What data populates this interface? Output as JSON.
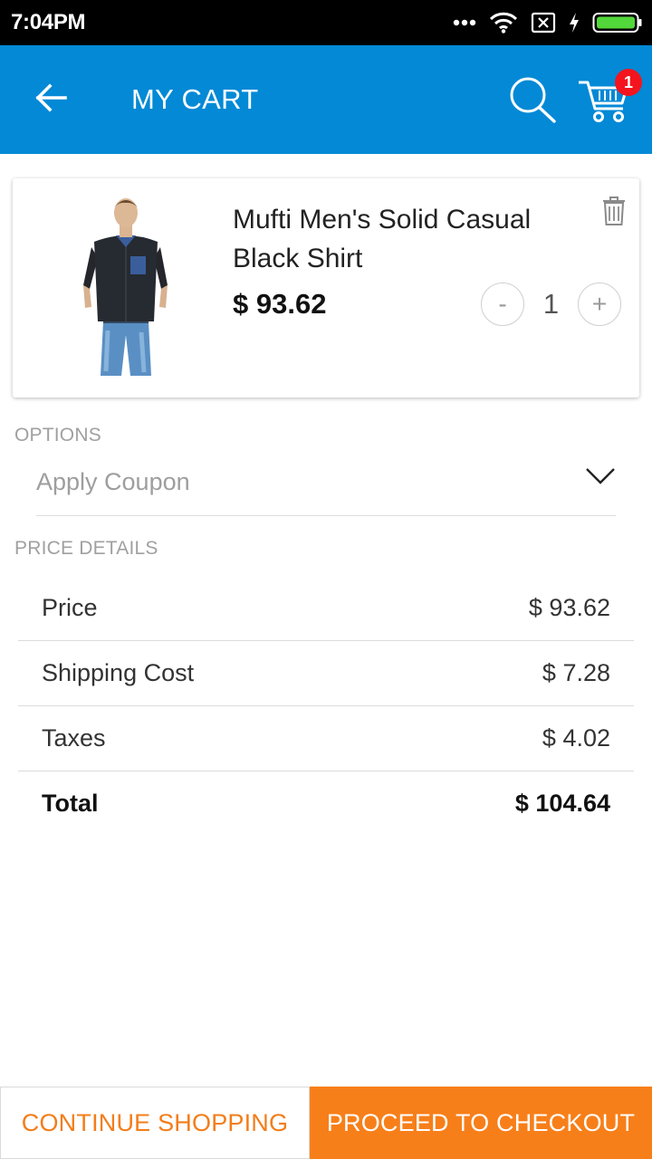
{
  "status_bar": {
    "time": "7:04PM",
    "icons": [
      "more-dots-icon",
      "wifi-icon",
      "no-sim-icon",
      "charging-icon",
      "battery-icon"
    ]
  },
  "app_bar": {
    "title": "MY CART",
    "cart_count": "1",
    "icons": [
      "back-arrow-icon",
      "search-icon",
      "shopping-cart-icon"
    ]
  },
  "cart_item": {
    "name": "Mufti Men's Solid Casual Black Shirt",
    "price": "$ 93.62",
    "quantity": "1",
    "minus_label": "-",
    "plus_label": "+",
    "image": "product-photo-man-in-black-shirt"
  },
  "options": {
    "section_label": "OPTIONS",
    "coupon_label": "Apply Coupon"
  },
  "price_details": {
    "section_label": "PRICE DETAILS",
    "rows": [
      {
        "label": "Price",
        "value": "$ 93.62"
      },
      {
        "label": "Shipping Cost",
        "value": "$ 7.28"
      },
      {
        "label": "Taxes",
        "value": "$ 4.02"
      },
      {
        "label": "Total",
        "value": "$ 104.64"
      }
    ]
  },
  "buttons": {
    "continue": "CONTINUE SHOPPING",
    "checkout": "PROCEED TO CHECKOUT"
  },
  "colors": {
    "app_bar": "#0389d6",
    "accent_orange": "#f77f19",
    "badge_red": "#f4141e"
  }
}
